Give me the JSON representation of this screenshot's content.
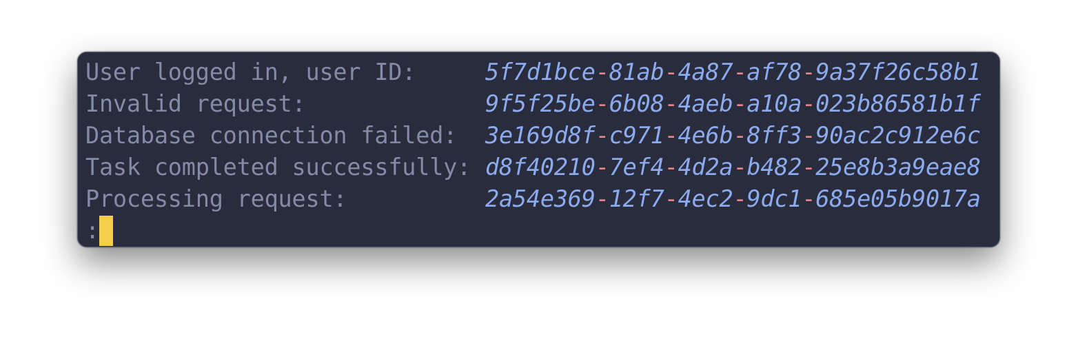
{
  "terminal": {
    "rows": [
      {
        "label": "User logged in, user ID:",
        "id_parts": [
          "5f7d1bce",
          "81ab",
          "4a87",
          "af78",
          "9a37f26c58b1"
        ]
      },
      {
        "label": "Invalid request:",
        "id_parts": [
          "9f5f25be",
          "6b08",
          "4aeb",
          "a10a",
          "023b86581b1f"
        ]
      },
      {
        "label": "Database connection failed:",
        "id_parts": [
          "3e169d8f",
          "c971",
          "4e6b",
          "8ff3",
          "90ac2c912e6c"
        ]
      },
      {
        "label": "Task completed successfully:",
        "id_parts": [
          "d8f40210",
          "7ef4",
          "4d2a",
          "b482",
          "25e8b3a9eae8"
        ]
      },
      {
        "label": "Processing request:",
        "id_parts": [
          "2a54e369",
          "12f7",
          "4ec2",
          "9dc1",
          "685e05b9017a"
        ]
      }
    ],
    "separator": "-",
    "prompt": ":"
  },
  "colors": {
    "background": "#292c3c",
    "label": "#838ba7",
    "uuid": "#8caaee",
    "separator": "#e78284",
    "cursor": "#f4cd4a"
  }
}
